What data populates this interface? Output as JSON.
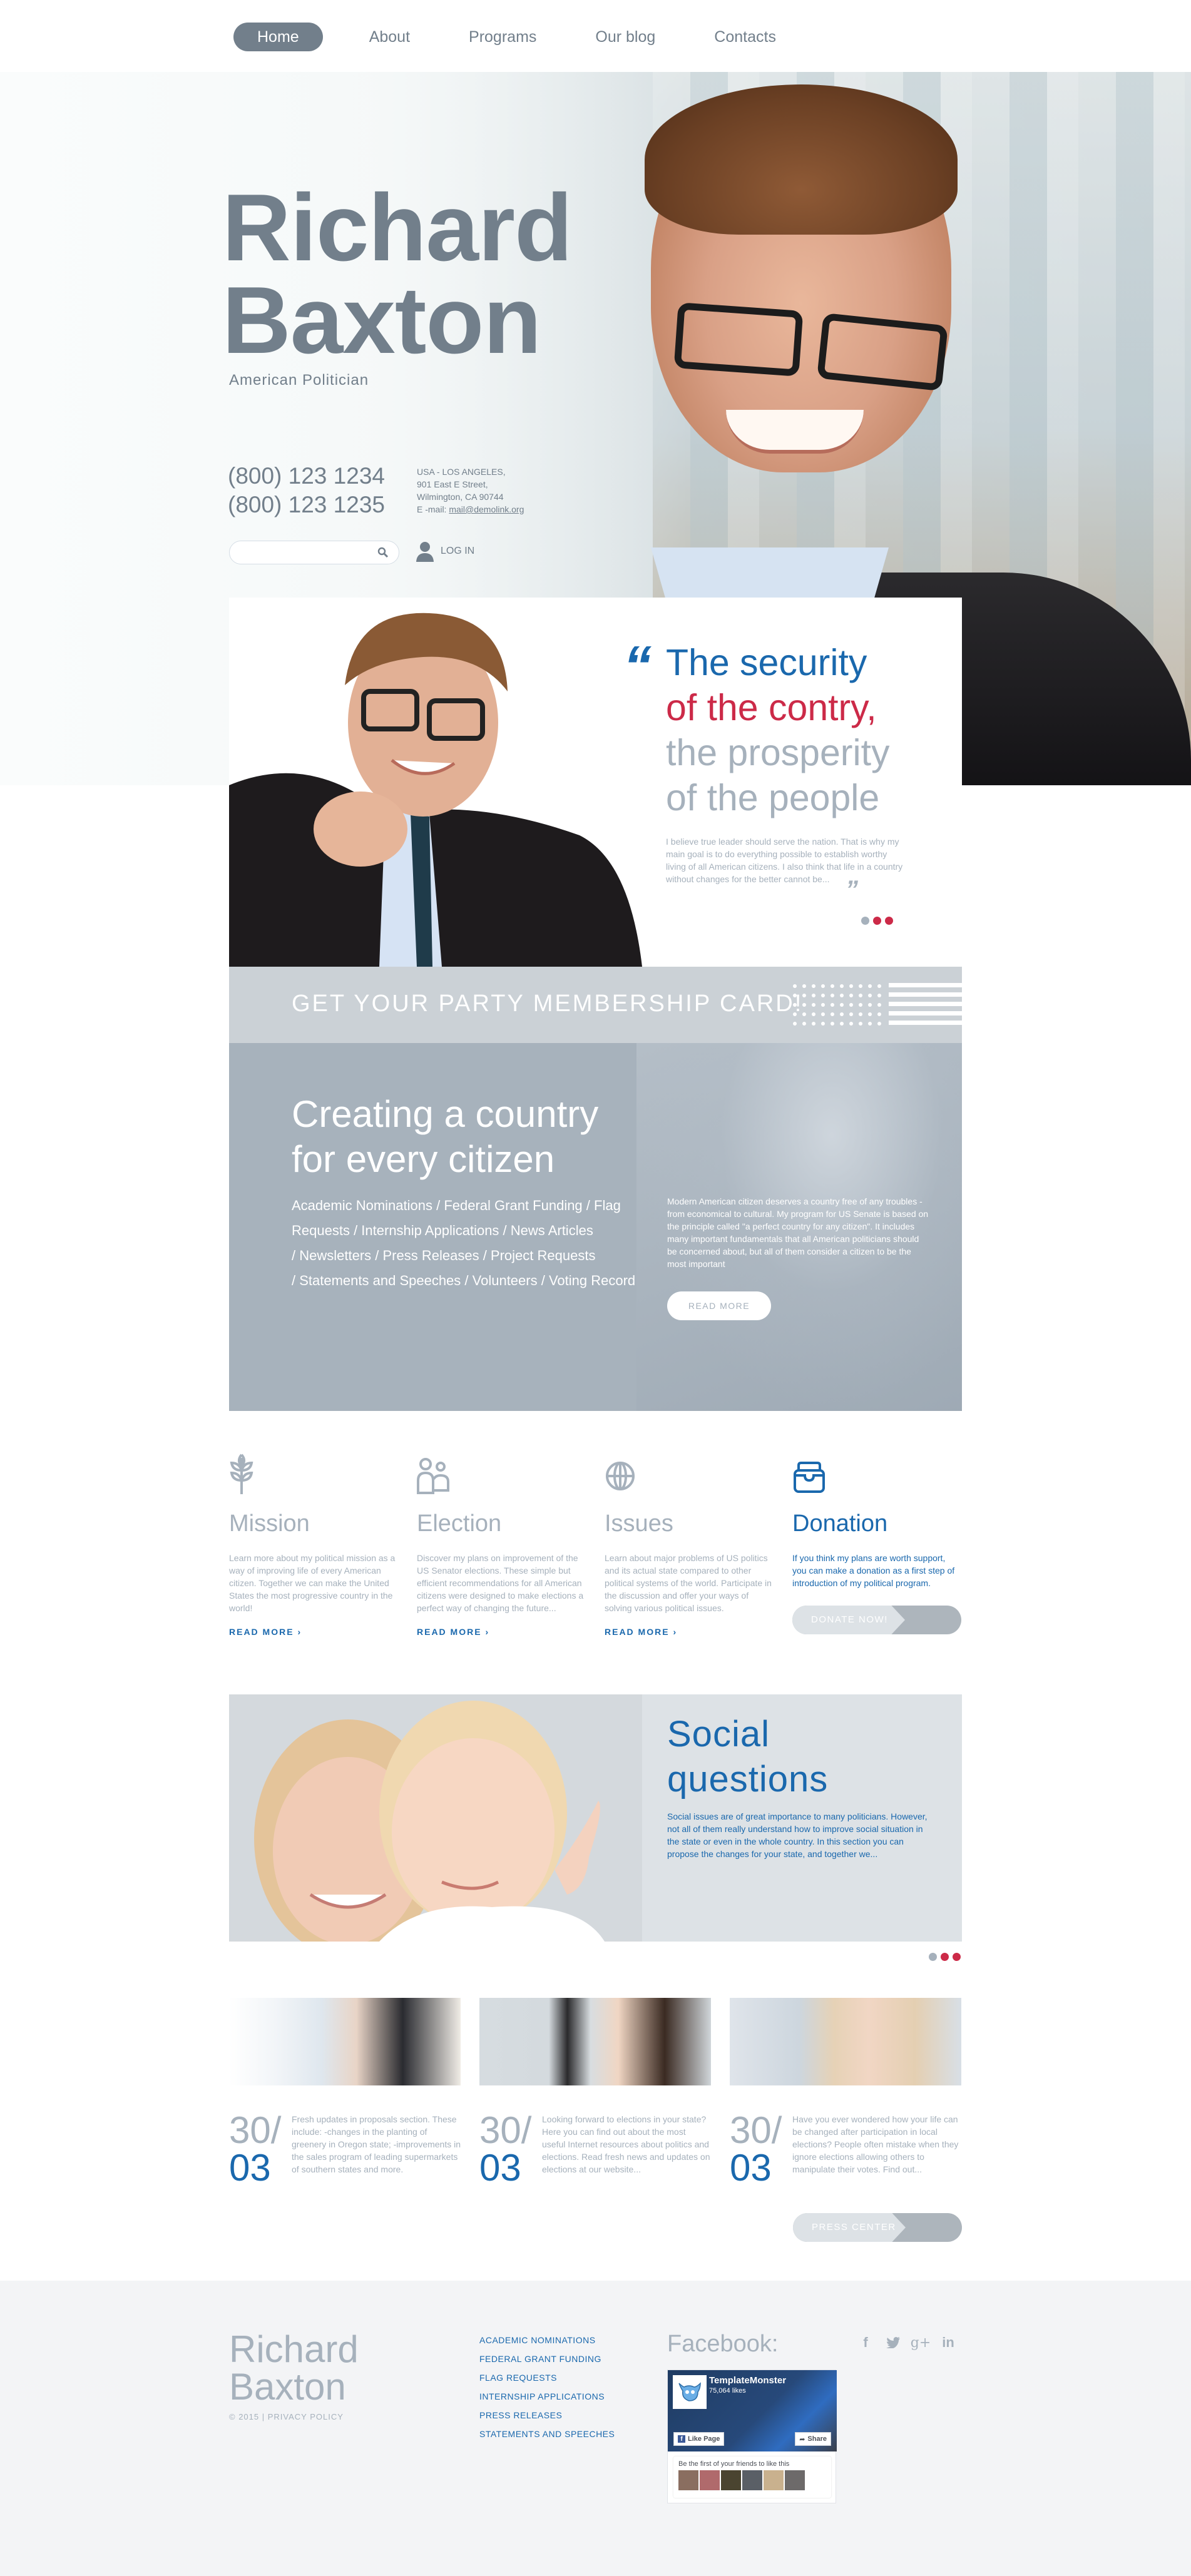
{
  "nav": {
    "items": [
      {
        "label": "Home",
        "active": true
      },
      {
        "label": "About",
        "active": false
      },
      {
        "label": "Programs",
        "active": false
      },
      {
        "label": "Our blog",
        "active": false
      },
      {
        "label": "Contacts",
        "active": false
      }
    ]
  },
  "hero": {
    "first_name": "Richard",
    "last_name": "Baxton",
    "subtitle": "American Politician",
    "phones": [
      "(800) 123 1234",
      "(800) 123 1235"
    ],
    "address": {
      "line1": "USA - LOS ANGELES,",
      "line2": "901 East E Street,",
      "line3": "Wilmington, CA 90744",
      "email_label": "E -mail: ",
      "email": "mail@demolink.org"
    },
    "search": {
      "placeholder": "",
      "value": "",
      "icon": "search-icon"
    },
    "login_label": "LOG IN",
    "login_icon": "user-icon"
  },
  "quote": {
    "open_mark": "“",
    "line1": "The security",
    "line2": "of  the contry,",
    "line3": "the prosperity",
    "line4": "of the people",
    "body": "I believe true leader should serve the nation. That is why my main goal is to do everything possible to establish worthy living of all American citizens. I also think that life in a country without changes for the better cannot be...",
    "close_mark": "”",
    "pager": {
      "count": 3,
      "active_index": 0
    }
  },
  "membership": {
    "text": "GET YOUR PARTY MEMBERSHIP CARD!"
  },
  "create": {
    "heading_line1": "Creating a country",
    "heading_line2": "for every citizen",
    "links": [
      "Academic Nominations",
      "Federal Grant Funding",
      "Flag Requests",
      "Internship Applications",
      "News Articles",
      "Newsletters",
      "Press Releases",
      "Project Requests",
      "Statements and Speeches",
      "Volunteers",
      "Voting Record"
    ],
    "separator": " / ",
    "body": "Modern American citizen deserves a country free of any troubles - from economical to cultural. My program for US Senate is based on the principle called \"a perfect country for any citizen\". It includes many important fundamentals that all American politicians should be concerned about, but all of them consider a citizen to be the most important",
    "button_label": "READ MORE"
  },
  "features": [
    {
      "icon": "wheat-icon",
      "title": "Mission",
      "body": "Learn more about my political mission as a way of improving life of every American citizen. Together we can make the United States the most progressive country in the world!",
      "link": "READ MORE ›"
    },
    {
      "icon": "people-icon",
      "title": "Election",
      "body": "Discover my plans on improvement of the US Senator elections. These simple but efficient recommendations for all American citizens were designed to make elections a perfect way of changing the future...",
      "link": "READ MORE ›"
    },
    {
      "icon": "globe-icon",
      "title": "Issues",
      "body": "Learn about major problems of US politics and its actual state compared to other political systems of the world. Participate in the discussion and offer your ways of solving various political issues.",
      "link": "READ MORE ›"
    },
    {
      "icon": "ballot-box-icon",
      "title": "Donation",
      "body": "If you think my plans are worth support, you can make a donation as a first step of introduction of my political program.",
      "button": "DONATE NOW!"
    }
  ],
  "social": {
    "heading_line1": "Social",
    "heading_line2": "questions",
    "body": "Social issues are of great importance to many politicians. However, not all of them really understand how to improve social situation in the state or even in the whole country. In this section you can propose the changes for your state, and together we...",
    "pager": {
      "count": 3,
      "active_index": 0
    }
  },
  "news": [
    {
      "day": "30/",
      "month": "03",
      "body": "Fresh updates in proposals section. These include: -changes in the planting of greenery in Oregon state; -improvements in the sales program of leading supermarkets of southern states and more."
    },
    {
      "day": "30/",
      "month": "03",
      "body": "Looking forward to elections in your state? Here you can find out about the most useful Internet resources about politics and elections. Read fresh news and updates on elections at our website..."
    },
    {
      "day": "30/",
      "month": "03",
      "body": "Have you ever wondered how your life can be changed after participation in local elections? People often mistake when they ignore elections allowing others to manipulate their votes. Find out..."
    }
  ],
  "press_button": "PRESS CENTER",
  "footer": {
    "name_line1": "Richard",
    "name_line2": "Baxton",
    "copyright": "© 2015 | PRIVACY POLICY",
    "links": [
      "ACADEMIC NOMINATIONS",
      "FEDERAL GRANT FUNDING",
      "FLAG REQUESTS",
      "INTERNSHIP APPLICATIONS",
      "PRESS RELEASES",
      "STATEMENTS AND SPEECHES"
    ],
    "facebook_heading": "Facebook:",
    "social_icons": [
      "facebook-icon",
      "twitter-icon",
      "google-plus-icon",
      "linkedin-icon"
    ],
    "fb_widget": {
      "page_name": "TemplateMonster",
      "likes": "75,064 likes",
      "like_button": "Like Page",
      "share_button": "Share",
      "friends_text": "Be the first of your friends to like this"
    }
  },
  "colors": {
    "primary_blue": "#1a68ad",
    "accent_red": "#cc2a48",
    "slate": "#727f8b",
    "muted": "#a6b1bc",
    "panel_grey": "#a7b2bc",
    "light_panel": "#dde2e6",
    "footer_bg": "#f3f4f6"
  }
}
